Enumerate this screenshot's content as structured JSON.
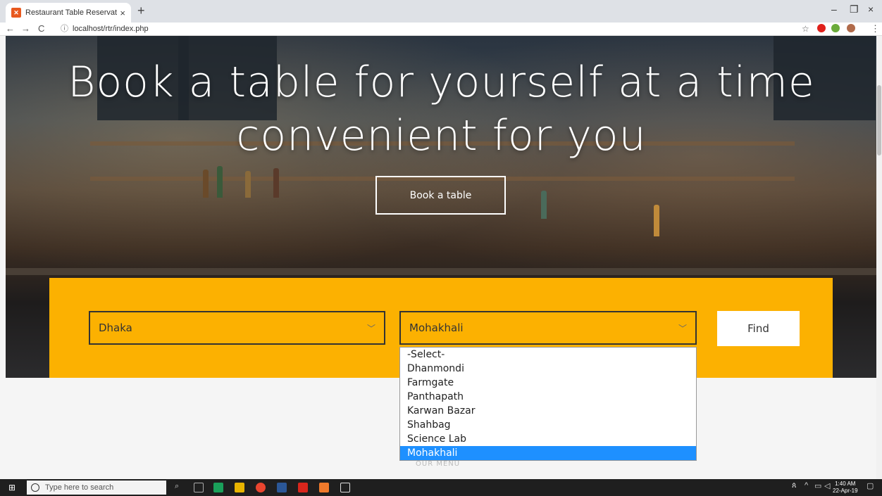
{
  "browser": {
    "tab_title": "Restaurant Table Reservation Sys",
    "tab_favicon": "xampp-icon",
    "url": "localhost/rtr/index.php",
    "new_tab": "+",
    "tab_close": "×",
    "win_min": "–",
    "win_max": "❐",
    "win_close": "×"
  },
  "hero": {
    "headline": "Book a table for yourself at a time convenient for you",
    "book_button": "Book a table"
  },
  "search": {
    "city": {
      "value": "Dhaka"
    },
    "area": {
      "value": "Mohakhali",
      "options": [
        "-Select-",
        "Dhanmondi",
        "Farmgate",
        "Panthapath",
        "Karwan Bazar",
        "Shahbag",
        "Science Lab",
        "Mohakhali"
      ],
      "selected_index": 7
    },
    "find_button": "Find"
  },
  "section": {
    "menu_label": "OUR MENU"
  },
  "taskbar": {
    "search_placeholder": "Type here to search",
    "time": "1:40 AM",
    "date": "22-Apr-19"
  },
  "colors": {
    "panel": "#fcb101",
    "selected_option": "#1e90ff"
  }
}
